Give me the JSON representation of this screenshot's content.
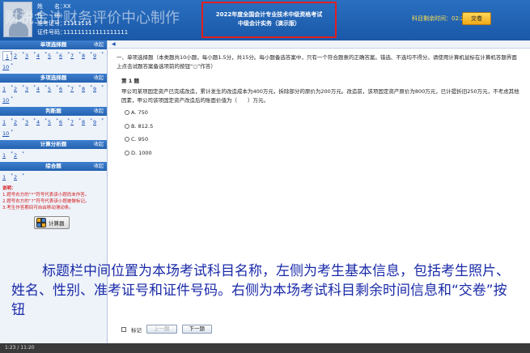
{
  "header": {
    "labels": {
      "name": "姓　　名：",
      "gender": "性　　别：",
      "admission": "准考证号：",
      "id": "证件号码："
    },
    "values": {
      "name": "XX",
      "gender": "",
      "admission": "11111111",
      "id": "111111111111111111"
    },
    "watermark": "财税金计财务评价中心制作",
    "exam_title_line1": "2022年度全国会计专业技术中级资格考试",
    "exam_title_line2": "中级会计实务（演示版）",
    "timer_label": "科目剩余时间：",
    "timer_value": "02:27:40",
    "submit_label": "交卷"
  },
  "sidebar": {
    "collapse_label": "收起",
    "sections": [
      {
        "title": "单项选择题",
        "numbers": [
          "1",
          "2",
          "3",
          "4",
          "5",
          "6",
          "7",
          "8",
          "9",
          "10"
        ]
      },
      {
        "title": "多项选择题",
        "numbers": [
          "1",
          "2",
          "3",
          "4",
          "5",
          "6",
          "7",
          "8",
          "9",
          "10"
        ]
      },
      {
        "title": "判断题",
        "numbers": [
          "1",
          "2",
          "3",
          "4",
          "5",
          "6",
          "7",
          "8",
          "9",
          "10"
        ]
      },
      {
        "title": "计算分析题",
        "numbers": [
          "1",
          "2"
        ]
      },
      {
        "title": "综合题",
        "numbers": [
          "1",
          "2"
        ]
      }
    ],
    "note_title": "说明：",
    "notes": [
      "1.题号右方的“*”符号代表该小题尚未作答。",
      "2.题号右方的“?”符号代表该小题被做标记。",
      "3.考生作答期间可自由移动滑动条。"
    ],
    "calculator_label": "计算器"
  },
  "main": {
    "instruction": "一、单项选择题（本类题共10小题，每小题1.5分，共15分。每小题备选答案中，只有一个符合题意的正确答案。错选、不选均不得分。请使用计算机鼠标在计算机答题界面上点击试题答案备选项前的按钮“○”作答）",
    "question_no": "第 1 题",
    "stem": "甲公司某项固定资产已完成改造，累计发生的改造成本为400万元，拆除部分的原价为200万元。改造前，该项固定资产原价为800万元，已计提折旧250万元，不考虑其他因素，甲公司该项固定资产改造后的账面价值为（　　）万元。",
    "options": [
      {
        "label": "A. 750"
      },
      {
        "label": "B. 812.5"
      },
      {
        "label": "C. 950"
      },
      {
        "label": "D. 1000"
      }
    ]
  },
  "caption": "标题栏中间位置为本场考试科目名称，左侧为考生基本信息，包括考生照片、姓名、性别、准考证号和证件号码。右侧为本场考试科目剩余时间信息和“交卷”按钮",
  "bottom": {
    "mark_label": "标记",
    "prev_label": "上一题",
    "next_label": "下一题"
  },
  "status": "1:23 / 11:20"
}
